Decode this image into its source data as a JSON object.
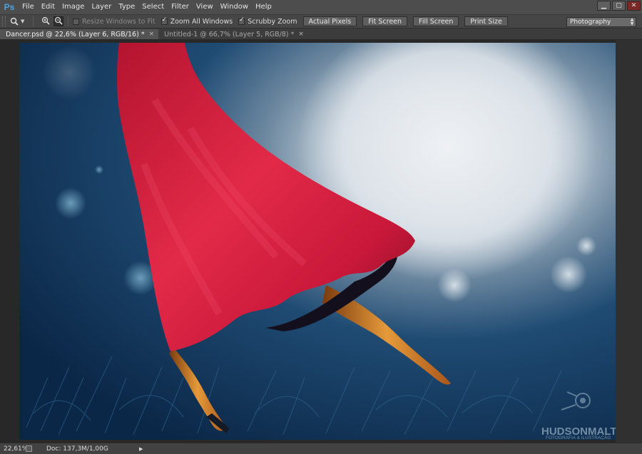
{
  "app": {
    "logo": "Ps",
    "menus": [
      "File",
      "Edit",
      "Image",
      "Layer",
      "Type",
      "Select",
      "Filter",
      "View",
      "Window",
      "Help"
    ],
    "window_controls": [
      "minimize-icon",
      "restore-icon",
      "close-icon"
    ]
  },
  "options_bar": {
    "tool_icon": "zoom-tool-icon",
    "zoom_in_icon": "zoom-in-icon",
    "zoom_out_icon": "zoom-out-icon",
    "resize_windows": {
      "label": "Resize Windows to Fit",
      "checked": false,
      "enabled": false
    },
    "zoom_all_windows": {
      "label": "Zoom All Windows",
      "checked": true
    },
    "scrubby_zoom": {
      "label": "Scrubby Zoom",
      "checked": true
    },
    "buttons": [
      "Actual Pixels",
      "Fit Screen",
      "Fill Screen",
      "Print Size"
    ],
    "workspace": "Photography"
  },
  "tabs": [
    {
      "label": "Dancer.psd @ 22,6% (Layer 6, RGB/16) *",
      "active": true
    },
    {
      "label": "Untitled-1 @ 66,7% (Layer 5, RGB/8) *",
      "active": false
    }
  ],
  "canvas": {
    "watermark_title": "HUDSONMALTA",
    "watermark_subtitle": "FOTOGRAFIA & ILUSTRAÇÃO",
    "colors": {
      "background": "#123253",
      "dress": "#d81e3c",
      "moon": "#e4e8ec",
      "skin": "#d88a2e"
    }
  },
  "status": {
    "zoom": "22,61%",
    "doc": "Doc: 137,3M/1,00G"
  }
}
